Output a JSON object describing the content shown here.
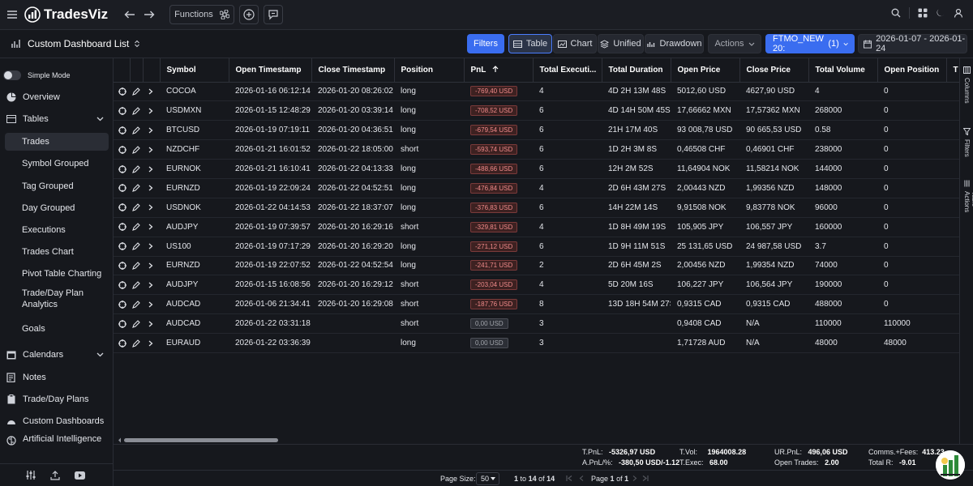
{
  "app": {
    "name": "TradesViz"
  },
  "topbar": {
    "functions_label": "Functions"
  },
  "dashboard": {
    "title": "Custom Dashboard List",
    "filters_label": "Filters",
    "view_tabs": [
      "Table",
      "Chart",
      "Unified",
      "Drawdown"
    ],
    "actions_label": "Actions",
    "account_label": "FTMO_NEW 20:",
    "account_count": "(1)",
    "date_range": "2026-01-07 - 2026-01-24"
  },
  "sidebar": {
    "simple_mode_label": "Simple Mode",
    "items": [
      {
        "label": "Overview"
      },
      {
        "label": "Tables"
      },
      {
        "label": "Trades"
      },
      {
        "label": "Symbol Grouped"
      },
      {
        "label": "Tag Grouped"
      },
      {
        "label": "Day Grouped"
      },
      {
        "label": "Executions"
      },
      {
        "label": "Trades Chart"
      },
      {
        "label": "Pivot Table Charting"
      },
      {
        "label": "Trade/Day Plan Analytics"
      },
      {
        "label": "Goals"
      },
      {
        "label": "Calendars"
      },
      {
        "label": "Notes"
      },
      {
        "label": "Trade/Day Plans"
      },
      {
        "label": "Custom Dashboards"
      },
      {
        "label": "Artificial Intelligence"
      }
    ]
  },
  "table": {
    "columns": [
      "Symbol",
      "Open Timestamp",
      "Close Timestamp",
      "Position",
      "PnL",
      "Total Executi...",
      "Total Duration",
      "Open Price",
      "Close Price",
      "Total Volume",
      "Open Position",
      "T"
    ],
    "rows": [
      {
        "symbol": "COCOA",
        "open_ts": "2026-01-16 06:12:14",
        "close_ts": "2026-01-20 08:26:02",
        "position": "long",
        "pnl": "-769,40 USD",
        "execs": "4",
        "duration": "4D 2H 13M 48S",
        "open_price": "5012,60 USD",
        "close_price": "4627,90 USD",
        "volume": "4",
        "open_pos": "0"
      },
      {
        "symbol": "USDMXN",
        "open_ts": "2026-01-15 12:48:29",
        "close_ts": "2026-01-20 03:39:14",
        "position": "long",
        "pnl": "-708,52 USD",
        "execs": "6",
        "duration": "4D 14H 50M 45S",
        "open_price": "17,66662 MXN",
        "close_price": "17,57362 MXN",
        "volume": "268000",
        "open_pos": "0"
      },
      {
        "symbol": "BTCUSD",
        "open_ts": "2026-01-19 07:19:11",
        "close_ts": "2026-01-20 04:36:51",
        "position": "long",
        "pnl": "-679,54 USD",
        "execs": "6",
        "duration": "21H 17M 40S",
        "open_price": "93 008,78 USD",
        "close_price": "90 665,53 USD",
        "volume": "0.58",
        "open_pos": "0"
      },
      {
        "symbol": "NZDCHF",
        "open_ts": "2026-01-21 16:01:52",
        "close_ts": "2026-01-22 18:05:00",
        "position": "short",
        "pnl": "-593,74 USD",
        "execs": "6",
        "duration": "1D 2H 3M 8S",
        "open_price": "0,46508 CHF",
        "close_price": "0,46901 CHF",
        "volume": "238000",
        "open_pos": "0"
      },
      {
        "symbol": "EURNOK",
        "open_ts": "2026-01-21 16:10:41",
        "close_ts": "2026-01-22 04:13:33",
        "position": "long",
        "pnl": "-488,66 USD",
        "execs": "6",
        "duration": "12H 2M 52S",
        "open_price": "11,64904 NOK",
        "close_price": "11,58214 NOK",
        "volume": "144000",
        "open_pos": "0"
      },
      {
        "symbol": "EURNZD",
        "open_ts": "2026-01-19 22:09:24",
        "close_ts": "2026-01-22 04:52:51",
        "position": "long",
        "pnl": "-476,84 USD",
        "execs": "4",
        "duration": "2D 6H 43M 27S",
        "open_price": "2,00443 NZD",
        "close_price": "1,99356 NZD",
        "volume": "148000",
        "open_pos": "0"
      },
      {
        "symbol": "USDNOK",
        "open_ts": "2026-01-22 04:14:53",
        "close_ts": "2026-01-22 18:37:07",
        "position": "long",
        "pnl": "-376,83 USD",
        "execs": "6",
        "duration": "14H 22M 14S",
        "open_price": "9,91508 NOK",
        "close_price": "9,83778 NOK",
        "volume": "96000",
        "open_pos": "0"
      },
      {
        "symbol": "AUDJPY",
        "open_ts": "2026-01-19 07:39:57",
        "close_ts": "2026-01-20 16:29:16",
        "position": "short",
        "pnl": "-329,81 USD",
        "execs": "4",
        "duration": "1D 8H 49M 19S",
        "open_price": "105,905 JPY",
        "close_price": "106,557 JPY",
        "volume": "160000",
        "open_pos": "0"
      },
      {
        "symbol": "US100",
        "open_ts": "2026-01-19 07:17:29",
        "close_ts": "2026-01-20 16:29:20",
        "position": "long",
        "pnl": "-271,12 USD",
        "execs": "6",
        "duration": "1D 9H 11M 51S",
        "open_price": "25 131,65 USD",
        "close_price": "24 987,58 USD",
        "volume": "3.7",
        "open_pos": "0"
      },
      {
        "symbol": "EURNZD",
        "open_ts": "2026-01-19 22:07:52",
        "close_ts": "2026-01-22 04:52:54",
        "position": "long",
        "pnl": "-241,71 USD",
        "execs": "2",
        "duration": "2D 6H 45M 2S",
        "open_price": "2,00456 NZD",
        "close_price": "1,99354 NZD",
        "volume": "74000",
        "open_pos": "0"
      },
      {
        "symbol": "AUDJPY",
        "open_ts": "2026-01-15 16:08:56",
        "close_ts": "2026-01-20 16:29:12",
        "position": "short",
        "pnl": "-203,04 USD",
        "execs": "4",
        "duration": "5D 20M 16S",
        "open_price": "106,227 JPY",
        "close_price": "106,564 JPY",
        "volume": "190000",
        "open_pos": "0"
      },
      {
        "symbol": "AUDCAD",
        "open_ts": "2026-01-06 21:34:41",
        "close_ts": "2026-01-20 16:29:08",
        "position": "short",
        "pnl": "-187,76 USD",
        "execs": "8",
        "duration": "13D 18H 54M 27S",
        "open_price": "0,9315 CAD",
        "close_price": "0,9315 CAD",
        "volume": "488000",
        "open_pos": "0"
      },
      {
        "symbol": "AUDCAD",
        "open_ts": "2026-01-22 03:31:18",
        "close_ts": "",
        "position": "short",
        "pnl": "0,00 USD",
        "execs": "3",
        "duration": "",
        "open_price": "0,9408 CAD",
        "close_price": "N/A",
        "volume": "110000",
        "open_pos": "110000"
      },
      {
        "symbol": "EURAUD",
        "open_ts": "2026-01-22 03:36:39",
        "close_ts": "",
        "position": "long",
        "pnl": "0,00 USD",
        "execs": "3",
        "duration": "",
        "open_price": "1,71728 AUD",
        "close_price": "N/A",
        "volume": "48000",
        "open_pos": "48000"
      }
    ]
  },
  "right_panel": {
    "labels": [
      "Columns",
      "Filters",
      "Table Actions"
    ]
  },
  "summary": {
    "tpnl_label": "T.PnL:",
    "tpnl": "-5326,97 USD",
    "apnl_label": "A.PnL/%:",
    "apnl": "-380,50 USD/-1.12",
    "tvol_label": "T.Vol:",
    "tvol": "1964008.28",
    "texec_label": "T.Exec:",
    "texec": "68.00",
    "urpnl_label": "UR.PnL:",
    "urpnl": "496,06 USD",
    "opentrades_label": "Open Trades:",
    "opentrades": "2.00",
    "comms_label": "Comms.+Fees:",
    "comms": "413.23",
    "totalr_label": "Total R:",
    "totalr": "-9.01"
  },
  "pagination": {
    "page_size_label": "Page Size:",
    "page_size": "50",
    "range_from": "1",
    "range_to": "14",
    "range_total": "14",
    "to_word": "to",
    "of_word": "of",
    "page_word": "Page",
    "page_current": "1",
    "page_total": "1"
  }
}
